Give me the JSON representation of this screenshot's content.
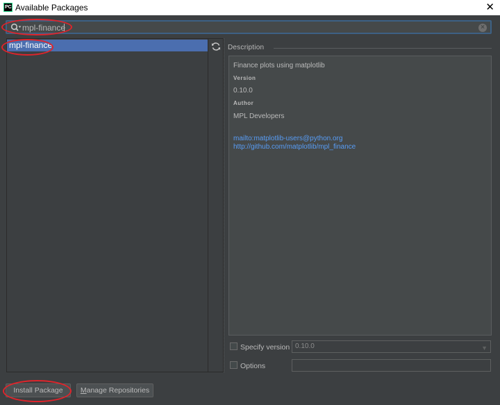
{
  "window": {
    "title": "Available Packages",
    "close_glyph": "✕"
  },
  "search": {
    "value": "mpl-finance",
    "placeholder": ""
  },
  "packages": [
    {
      "name": "mpl-finance"
    }
  ],
  "description": {
    "label": "Description",
    "summary": "Finance plots using matplotlib",
    "version_heading": "Version",
    "version": "0.10.0",
    "author_heading": "Author",
    "author": "MPL Developers",
    "links": [
      "mailto:matplotlib-users@python.org",
      "http://github.com/matplotlib/mpl_finance"
    ]
  },
  "options": {
    "specify_version_label": "Specify version",
    "specify_version_value": "0.10.0",
    "options_label": "Options",
    "options_value": ""
  },
  "buttons": {
    "install": "Install Package",
    "manage_repos_first": "M",
    "manage_repos_rest": "anage Repositories"
  },
  "colors": {
    "selection": "#4b6eaf",
    "link": "#589df6",
    "annotation": "#e0242b"
  }
}
